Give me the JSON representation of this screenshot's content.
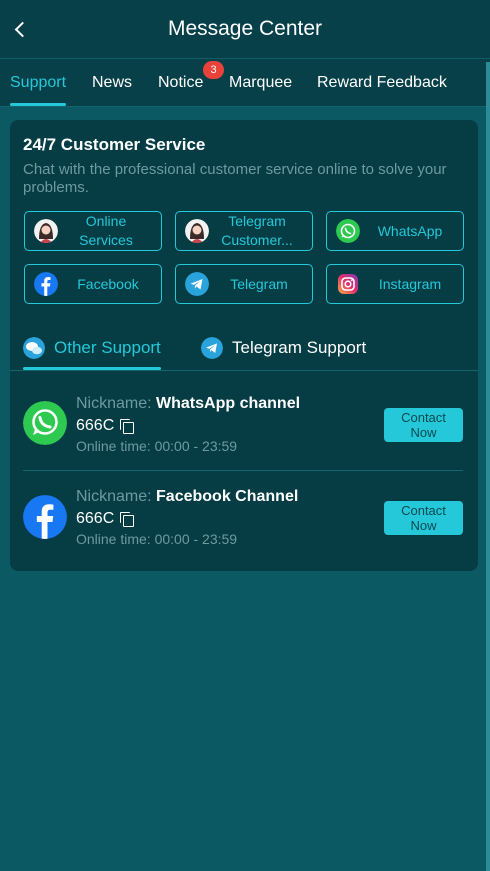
{
  "header": {
    "title": "Message Center",
    "back_icon": "chevron-left-icon"
  },
  "tabs": [
    {
      "label": "Support",
      "active": true
    },
    {
      "label": "News"
    },
    {
      "label": "Notice",
      "badge": "3"
    },
    {
      "label": "Marquee"
    },
    {
      "label": "Reward Feedback"
    }
  ],
  "colors": {
    "accent": "#25c8d8",
    "background": "#0b5a63",
    "header": "#074048",
    "card": "#063d45",
    "badge": "#e8423b"
  },
  "customer_service": {
    "title": "24/7 Customer Service",
    "description": "Chat with the professional customer service online to solve your problems.",
    "channels": [
      {
        "label_line1": "Online",
        "label_line2": "Services",
        "icon": "agent-avatar-icon"
      },
      {
        "label_line1": "Telegram",
        "label_line2": "Customer...",
        "icon": "agent-avatar-icon"
      },
      {
        "label": "WhatsApp",
        "icon": "whatsapp-icon"
      },
      {
        "label": "Facebook",
        "icon": "facebook-icon"
      },
      {
        "label": "Telegram",
        "icon": "telegram-icon"
      },
      {
        "label": "Instagram",
        "icon": "instagram-icon"
      }
    ]
  },
  "support_tabs": [
    {
      "label": "Other Support",
      "active": true,
      "icon": "chat-bubbles-icon"
    },
    {
      "label": "Telegram Support",
      "icon": "telegram-icon"
    }
  ],
  "contacts": [
    {
      "nickname_label": "Nickname: ",
      "nickname": "WhatsApp channel",
      "account": "666C",
      "online_time": "Online time: 00:00 - 23:59",
      "button_line1": "Contact",
      "button_line2": "Now",
      "icon": "whatsapp-icon"
    },
    {
      "nickname_label": "Nickname: ",
      "nickname": "Facebook Channel",
      "account": "666C",
      "online_time": "Online time: 00:00 - 23:59",
      "button_line1": "Contact",
      "button_line2": "Now",
      "icon": "facebook-icon"
    }
  ]
}
